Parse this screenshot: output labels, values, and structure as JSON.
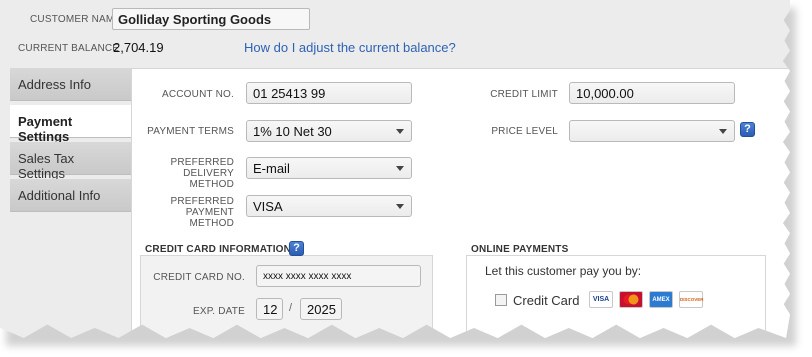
{
  "header": {
    "customer_name_label": "CUSTOMER NAME",
    "customer_name_value": "Golliday Sporting Goods",
    "current_balance_label": "CURRENT BALANCE",
    "current_balance_value": "2,704.19",
    "adjust_balance_link": "How do I adjust the current balance?"
  },
  "tabs": [
    {
      "label": "Address Info",
      "active": false
    },
    {
      "label": "Payment Settings",
      "active": true
    },
    {
      "label": "Sales Tax Settings",
      "active": false
    },
    {
      "label": "Additional Info",
      "active": false
    }
  ],
  "payment": {
    "account_no_label": "ACCOUNT NO.",
    "account_no_value": "01 25413 99",
    "payment_terms_label": "PAYMENT TERMS",
    "payment_terms_value": "1% 10 Net 30",
    "delivery_label_line1": "PREFERRED",
    "delivery_label_line2": "DELIVERY METHOD",
    "delivery_value": "E-mail",
    "pay_method_label_line1": "PREFERRED",
    "pay_method_label_line2": "PAYMENT METHOD",
    "pay_method_value": "VISA",
    "credit_limit_label": "CREDIT LIMIT",
    "credit_limit_value": "10,000.00",
    "price_level_label": "PRICE LEVEL",
    "price_level_value": ""
  },
  "credit_card": {
    "title": "CREDIT CARD INFORMATION",
    "number_label": "CREDIT CARD NO.",
    "number_value": "xxxx xxxx xxxx xxxx",
    "exp_label": "EXP. DATE",
    "exp_month": "12",
    "exp_separator": "/",
    "exp_year": "2025"
  },
  "online_payments": {
    "title": "ONLINE PAYMENTS",
    "subtitle": "Let this customer pay you by:",
    "credit_card_option": "Credit Card",
    "cards": [
      "VISA",
      "MC",
      "AMEX",
      "DISCOVER"
    ]
  },
  "colors": {
    "link": "#2e62b5",
    "help_button": "#3a6fc8",
    "tab_inactive": "#d0d0d0",
    "tab_active": "#ffffff"
  },
  "icons": {
    "help": "question-mark",
    "dropdown": "chevron-down"
  }
}
